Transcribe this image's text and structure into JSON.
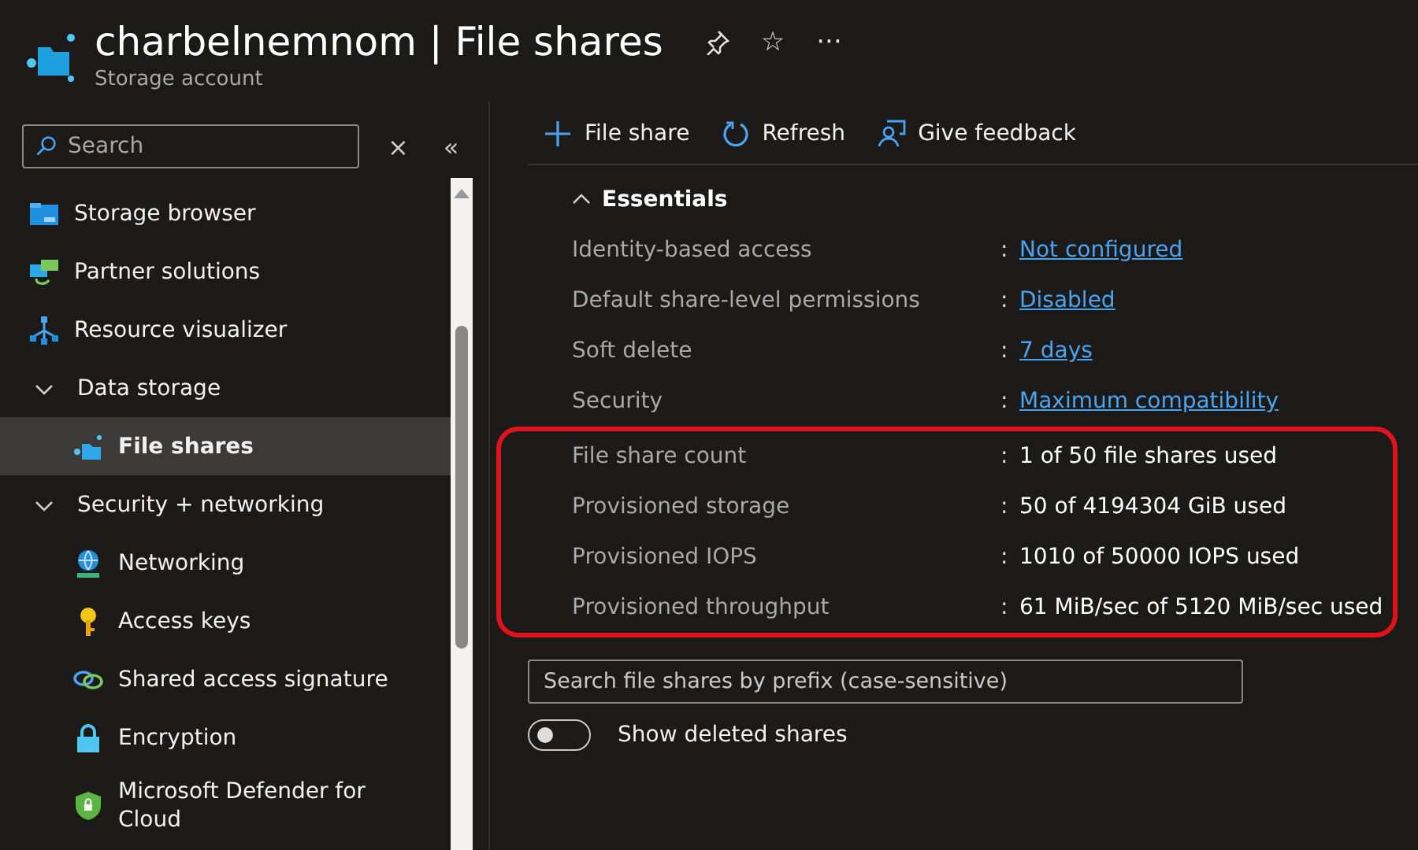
{
  "header": {
    "title": "charbelnemnom | File shares",
    "subtitle": "Storage account",
    "actions": [
      "☆",
      "···"
    ]
  },
  "sidebar": {
    "search": {
      "placeholder": "Search"
    },
    "clear": "×",
    "collapse": "«",
    "items": [
      {
        "label": "Storage browser",
        "selected": false
      },
      {
        "label": "Partner solutions",
        "selected": false
      },
      {
        "label": "Resource visualizer",
        "selected": false
      },
      {
        "label": "Data storage",
        "expanded": true,
        "children": [
          {
            "label": "File shares",
            "selected": true
          }
        ]
      },
      {
        "label": "Security + networking",
        "expanded": true,
        "children": [
          {
            "label": "Networking",
            "selected": false
          },
          {
            "label": "Access keys",
            "selected": false
          },
          {
            "label": "Shared access signature",
            "selected": false
          },
          {
            "label": "Encryption",
            "selected": false
          },
          {
            "label": "Microsoft Defender for Cloud",
            "selected": false
          }
        ]
      }
    ]
  },
  "toolbar": [
    "File share",
    "Refresh",
    "Give feedback"
  ],
  "essentials": {
    "title": "Essentials",
    "expanded": true,
    "rows": [
      {
        "label": "Identity-based access",
        "separator": ":",
        "value": "Not configured",
        "kind": "link"
      },
      {
        "label": "Default share-level permissions",
        "separator": ":",
        "value": "Disabled",
        "kind": "link"
      },
      {
        "label": "Soft delete",
        "separator": ":",
        "value": "7 days",
        "kind": "link"
      },
      {
        "label": "Security",
        "separator": ":",
        "value": "Maximum compatibility",
        "kind": "link"
      }
    ],
    "highlighted_rows": [
      {
        "label": "File share count",
        "separator": ":",
        "value": "1 of 50 file shares used",
        "kind": "text"
      },
      {
        "label": "Provisioned storage",
        "separator": ":",
        "value": "50 of 4194304 GiB used",
        "kind": "text"
      },
      {
        "label": "Provisioned IOPS",
        "separator": ":",
        "value": "1010 of 50000 IOPS used",
        "kind": "text"
      },
      {
        "label": "Provisioned throughput",
        "separator": ":",
        "value": "61 MiB/sec of 5120 MiB/sec used",
        "kind": "text"
      }
    ]
  },
  "filter": {
    "placeholder": "Search file shares by prefix (case-sensitive)"
  },
  "toggle": {
    "label": "Show deleted shares",
    "on": false
  }
}
